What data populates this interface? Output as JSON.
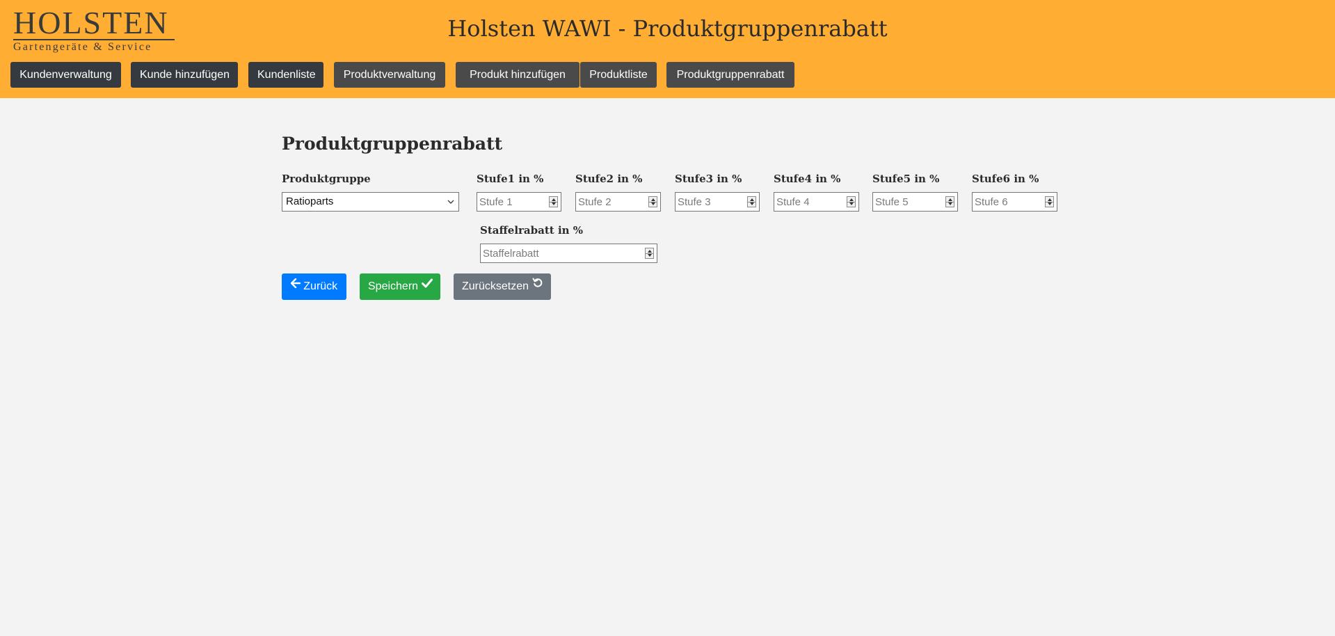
{
  "logo": {
    "main": "HOLSTEN",
    "sub": "Gartengeräte & Service"
  },
  "app_title": "Holsten WAWI - Produktgruppenrabatt",
  "nav": {
    "items": [
      {
        "label": "Kundenverwaltung"
      },
      {
        "label": "Kunde hinzufügen"
      },
      {
        "label": "Kundenliste"
      },
      {
        "label": "Produktverwaltung"
      },
      {
        "label": "Produkt hinzufügen"
      },
      {
        "label": "Produktliste"
      },
      {
        "label": "Produktgruppenrabatt"
      }
    ]
  },
  "form": {
    "title": "Produktgruppenrabatt",
    "produktgruppe": {
      "label": "Produktgruppe",
      "value": "Ratioparts"
    },
    "stufen": [
      {
        "label": "Stufe1 in %",
        "placeholder": "Stufe 1"
      },
      {
        "label": "Stufe2 in %",
        "placeholder": "Stufe 2"
      },
      {
        "label": "Stufe3 in %",
        "placeholder": "Stufe 3"
      },
      {
        "label": "Stufe4 in %",
        "placeholder": "Stufe 4"
      },
      {
        "label": "Stufe5 in %",
        "placeholder": "Stufe 5"
      },
      {
        "label": "Stufe6 in %",
        "placeholder": "Stufe 6"
      }
    ],
    "staffelrabatt": {
      "label": "Staffelrabatt in %",
      "placeholder": "Staffelrabatt"
    }
  },
  "actions": {
    "back_label": "Zurück",
    "save_label": "Speichern",
    "reset_label": "Zurücksetzen"
  },
  "icons": {
    "back": "arrow-left-icon",
    "save": "check-icon",
    "reset": "undo-icon"
  },
  "colors": {
    "header": "#ffae33",
    "background": "#f3f3f3",
    "nav_dark": "#343a40",
    "nav_gray": "#4a4a4a",
    "primary": "#007bff",
    "success": "#28a745",
    "secondary": "#6c757d"
  }
}
